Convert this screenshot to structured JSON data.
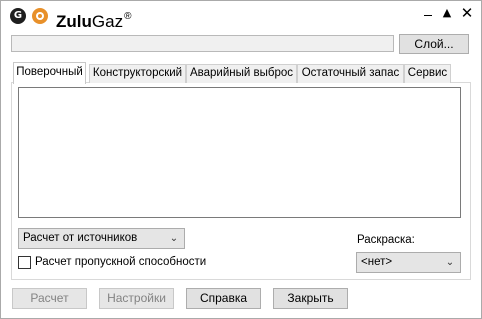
{
  "window": {
    "title_prefix": "Zulu",
    "title_suffix": "Gaz",
    "title_mark": "®",
    "icon_letter": "G",
    "controls": {
      "up": "▲",
      "close": "✕"
    }
  },
  "layer": {
    "path_value": "",
    "button_label": "Слой..."
  },
  "tabs": [
    {
      "label": "Поверочный",
      "active": true
    },
    {
      "label": "Конструкторский",
      "active": false
    },
    {
      "label": "Аварийный выброс",
      "active": false
    },
    {
      "label": "Остаточный запас",
      "active": false
    },
    {
      "label": "Сервис",
      "active": false
    }
  ],
  "options": {
    "calc_mode_selected": "Расчет от источников",
    "capacity_check_label": "Расчет пропускной способности",
    "capacity_checked": false,
    "coloring_label": "Раскраска:",
    "coloring_selected": "<нет>"
  },
  "buttons": {
    "calc": "Расчет",
    "settings": "Настройки",
    "help": "Справка",
    "close": "Закрыть"
  },
  "colors": {
    "icon_orange": "#e8902a",
    "icon_dark": "#1e1e1e"
  }
}
